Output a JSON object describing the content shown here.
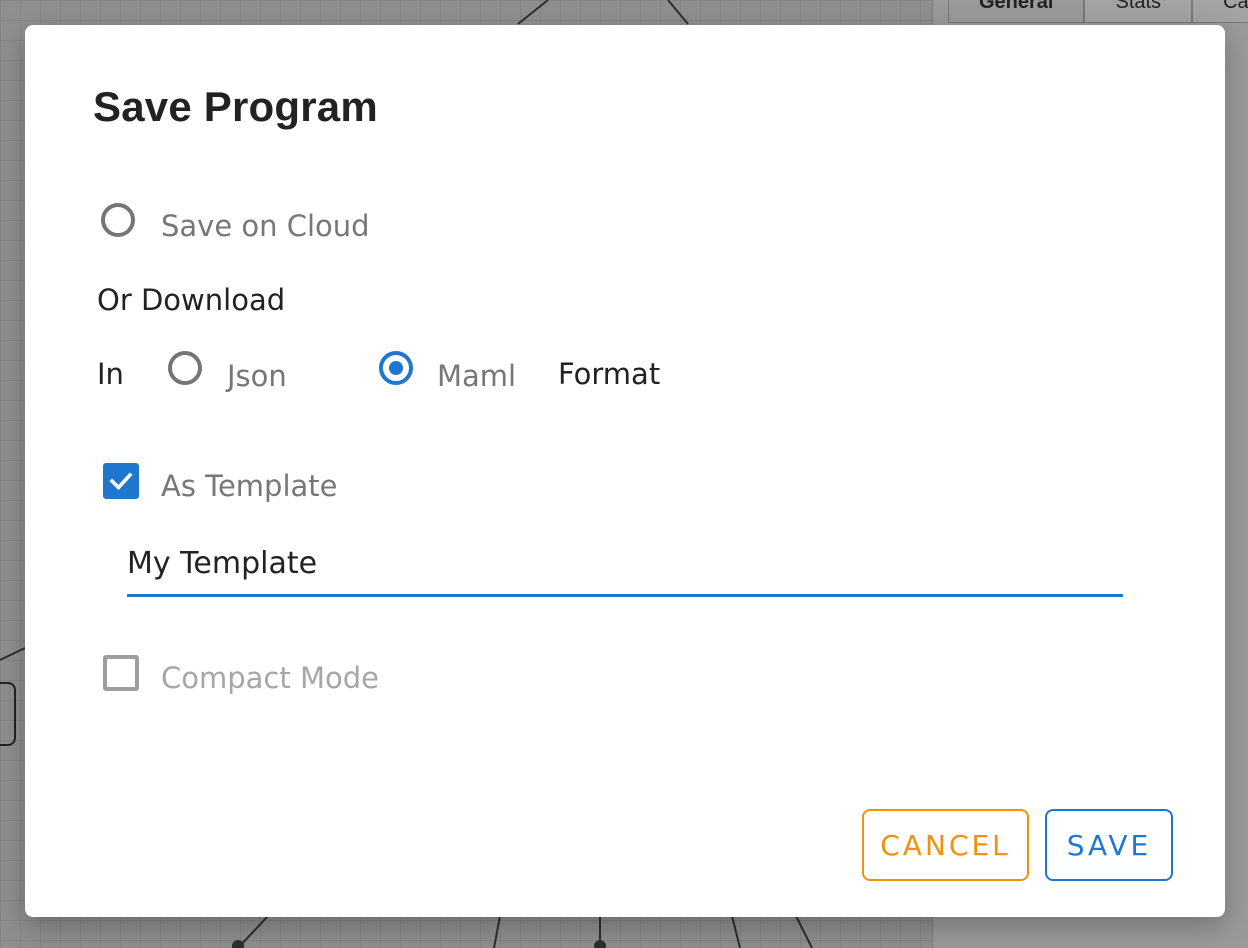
{
  "background": {
    "tabs": [
      "General",
      "Stats",
      "Ca"
    ]
  },
  "dialog": {
    "title": "Save Program",
    "save_on_cloud": {
      "label": "Save on Cloud",
      "checked": false
    },
    "or_download_label": "Or Download",
    "in_label": "In",
    "format_options": [
      {
        "label": "Json",
        "checked": false
      },
      {
        "label": "Maml",
        "checked": true
      }
    ],
    "format_label": "Format",
    "as_template": {
      "label": "As Template",
      "checked": true
    },
    "template_name": {
      "value": "My Template",
      "placeholder": ""
    },
    "compact_mode": {
      "label": "Compact Mode",
      "checked": false,
      "disabled": true
    },
    "buttons": {
      "cancel": "CANCEL",
      "save": "SAVE"
    }
  },
  "colors": {
    "accent": "#1f77d0",
    "cancel": "#f0920c",
    "overlay": "#8f8f8f"
  }
}
